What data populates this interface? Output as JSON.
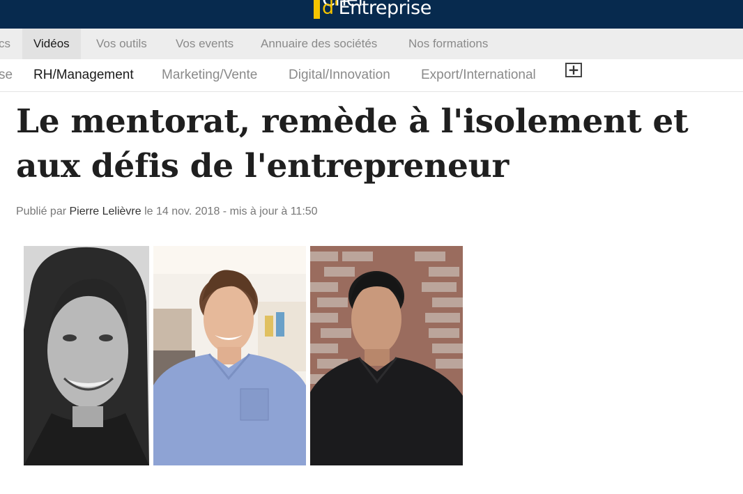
{
  "header": {
    "logo_line1": "Chef",
    "logo_line2_prefix": "d'",
    "logo_line2_rest": "Entreprise",
    "brand_color": "#072a4e",
    "accent_color": "#f5c400"
  },
  "nav_primary": {
    "items": [
      "cs",
      "Vidéos",
      "Vos outils",
      "Vos events",
      "Annuaire des sociétés",
      "Nos formations"
    ],
    "active": "Vidéos"
  },
  "nav_secondary": {
    "items": [
      "se",
      "RH/Management",
      "Marketing/Vente",
      "Digital/Innovation",
      "Export/International"
    ],
    "active": "RH/Management",
    "more_icon": "plus-box-icon",
    "more_label": "+"
  },
  "article": {
    "title": "Le mentorat, remède à l'isolement et aux défis de l'entrepreneur",
    "byline_prefix": "Publié par",
    "author": "Pierre Lelièvre",
    "byline_suffix": "le 14 nov. 2018 - mis à jour à 11:50"
  }
}
